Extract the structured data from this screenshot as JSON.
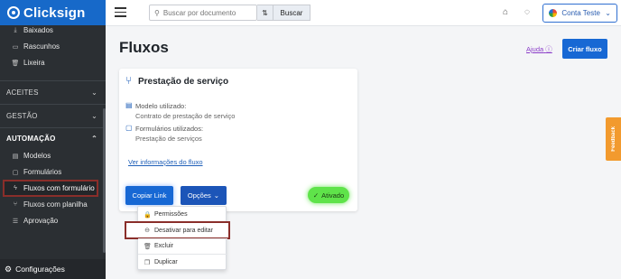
{
  "app": {
    "brand": "Clicksign"
  },
  "sidebar": {
    "top_items": [
      {
        "label": "Baixados",
        "icon": "download-icon"
      },
      {
        "label": "Rascunhos",
        "icon": "draft-icon"
      },
      {
        "label": "Lixeira",
        "icon": "trash-icon"
      }
    ],
    "sections": [
      {
        "label": "ACEITES"
      },
      {
        "label": "GESTÃO"
      },
      {
        "label": "AUTOMAÇÃO"
      }
    ],
    "automation_items": [
      {
        "label": "Modelos",
        "icon": "template-icon"
      },
      {
        "label": "Formulários",
        "icon": "form-icon"
      },
      {
        "label": "Fluxos com formulário",
        "icon": "flow-icon"
      },
      {
        "label": "Fluxos com planilha",
        "icon": "sheet-flow-icon"
      },
      {
        "label": "Aprovação",
        "icon": "approval-icon"
      }
    ],
    "footer": {
      "label": "Configurações",
      "icon": "gear-icon"
    }
  },
  "topbar": {
    "search_placeholder": "Buscar por documento",
    "search_button": "Buscar",
    "account_label": "Conta Teste"
  },
  "main": {
    "title": "Fluxos",
    "help_label": "Ajuda",
    "create_button": "Criar fluxo"
  },
  "card": {
    "title": "Prestação de serviço",
    "model_label": "Modelo utilizado:",
    "model_value": "Contrato de prestação de serviço",
    "forms_label": "Formulários utilizados:",
    "forms_value": "Prestação de serviços",
    "details_link": "Ver informações do fluxo",
    "copy_button": "Copiar Link",
    "options_button": "Opções",
    "status": "Ativado"
  },
  "options_menu": [
    {
      "label": "Permissões",
      "icon": "lock-icon"
    },
    {
      "label": "Desativar para editar",
      "icon": "disable-icon"
    },
    {
      "label": "Excluir",
      "icon": "trash-icon"
    },
    {
      "label": "Duplicar",
      "icon": "copy-icon"
    }
  ],
  "feedback_tab": "Feedback",
  "colors": {
    "brand_blue": "#1768d4",
    "sidebar_bg": "#2b2f33",
    "status_green": "#5fe34a",
    "highlight_red": "#8a2e2a",
    "feedback_orange": "#f29a2e"
  }
}
